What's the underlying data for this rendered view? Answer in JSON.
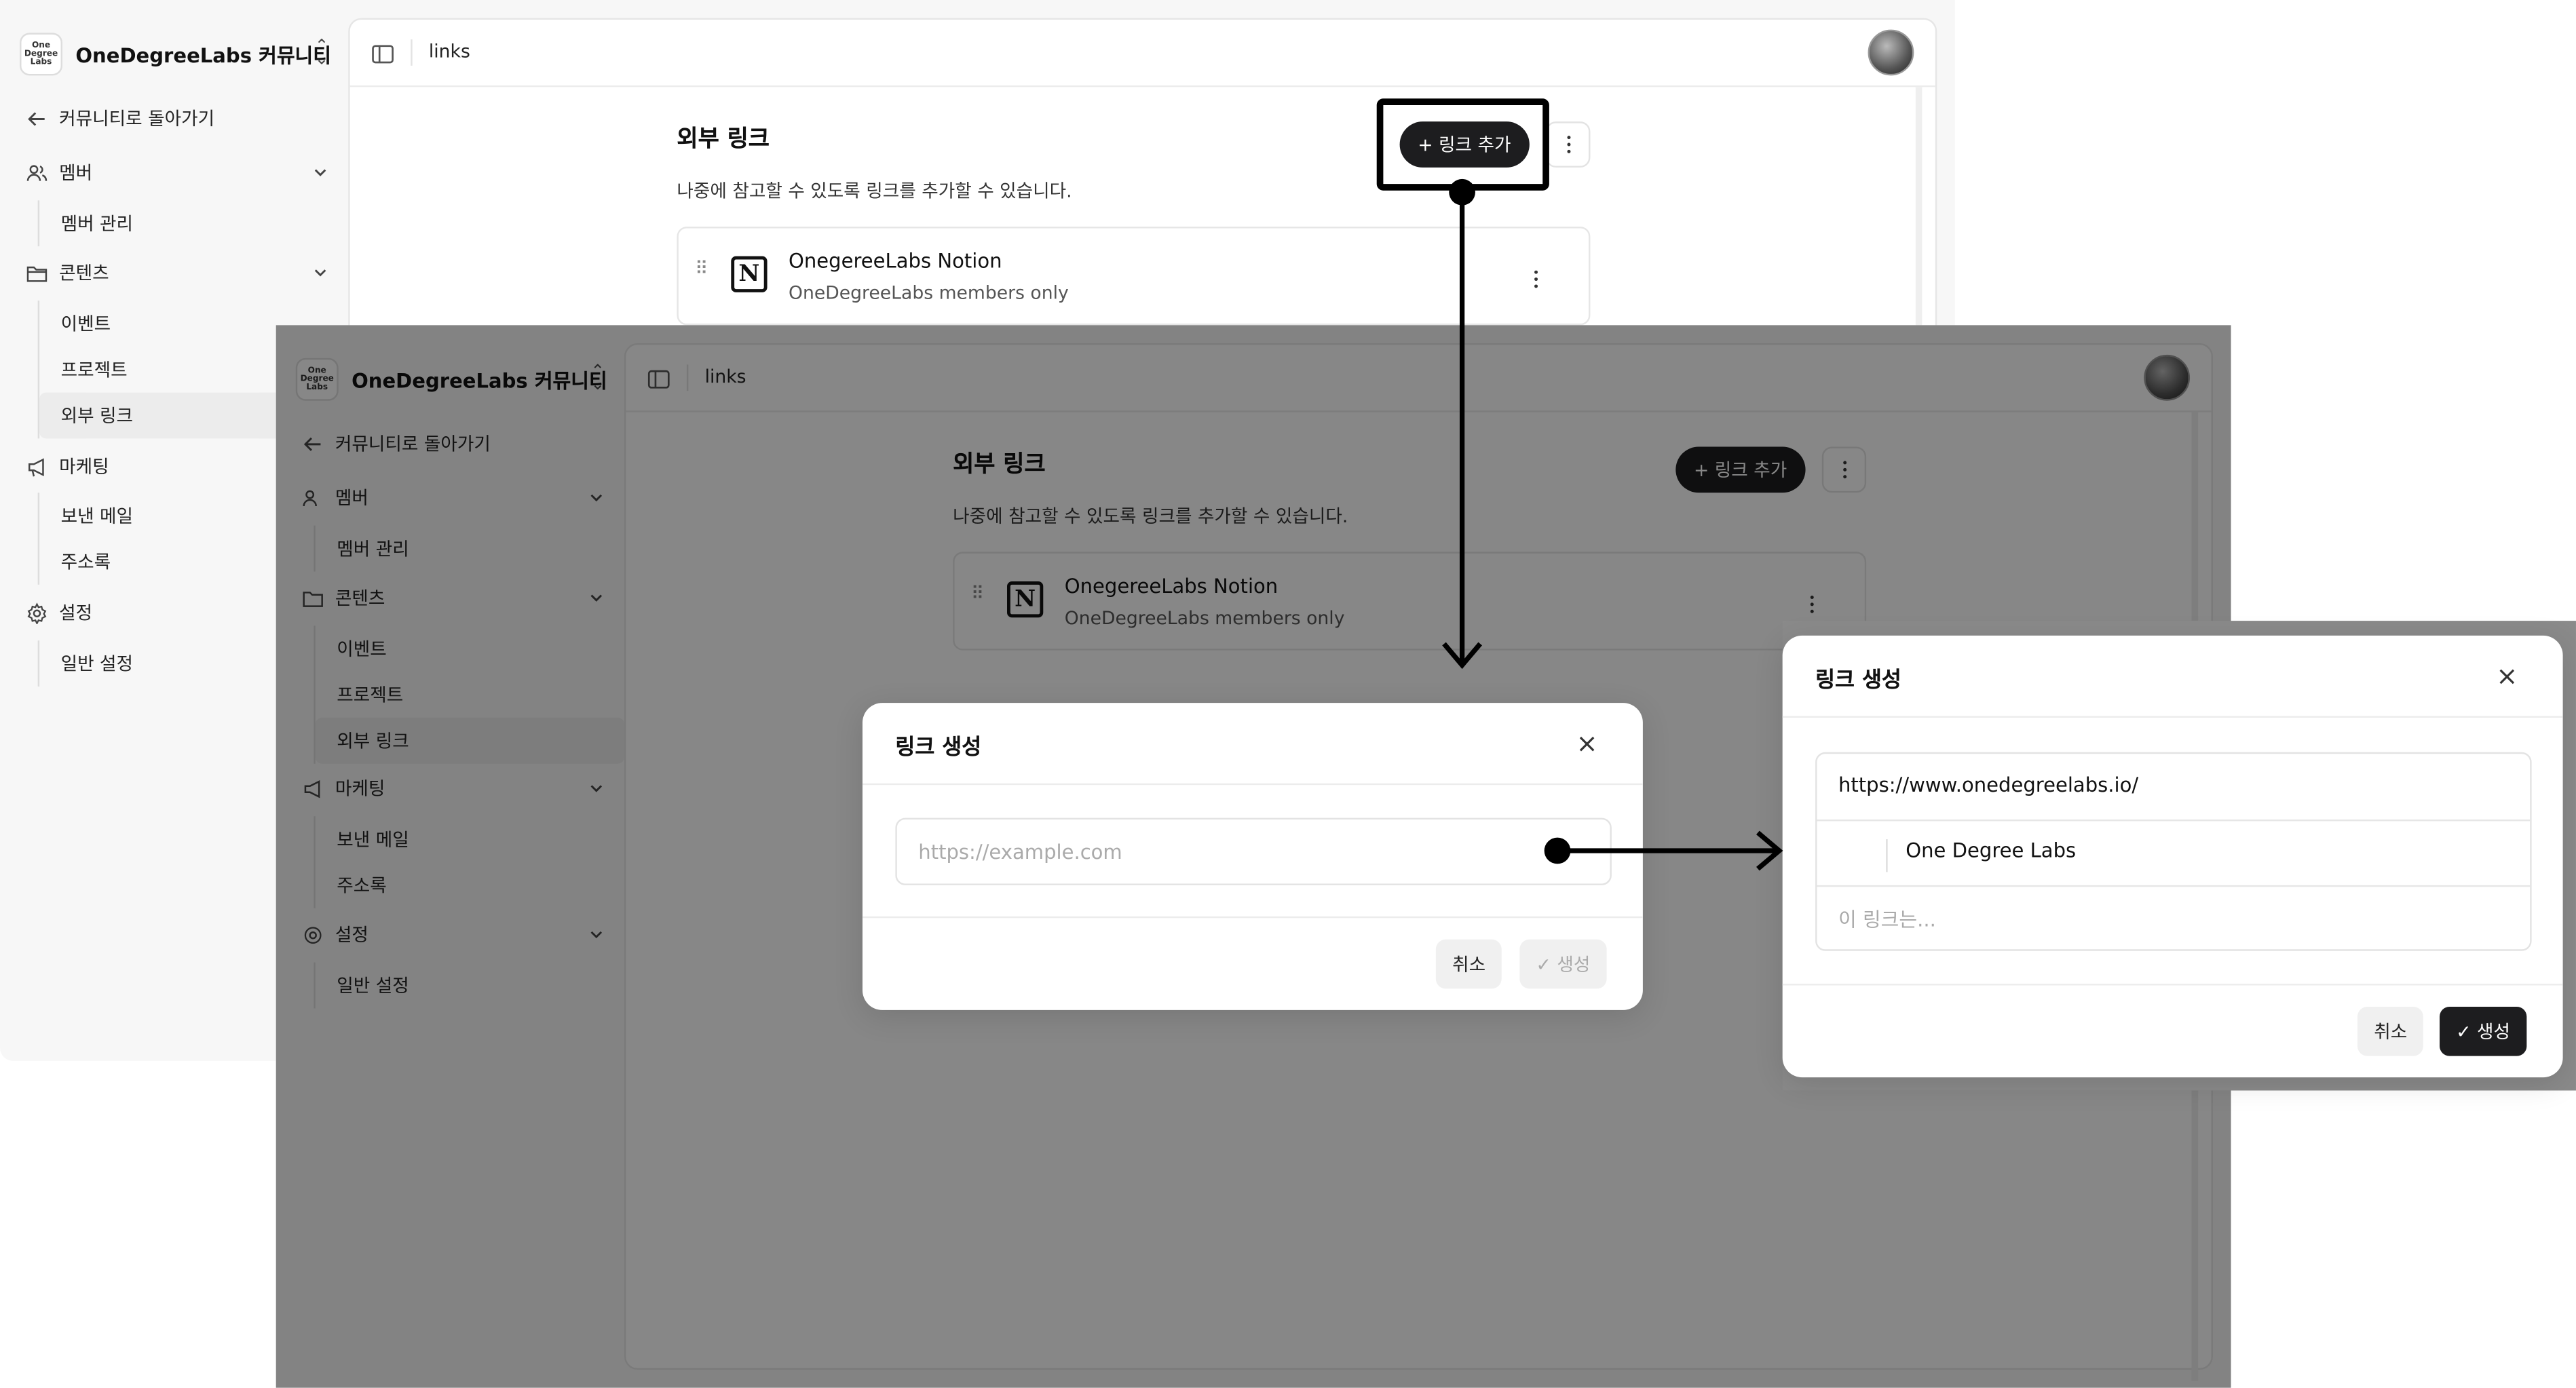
{
  "sidebar": {
    "org_logo": "One Degree Labs",
    "org_name": "OneDegreeLabs 커뮤니티",
    "back_label": "커뮤니티로 돌아가기",
    "groups": [
      {
        "label": "멤버",
        "icon": "users-icon",
        "items": [
          "멤버 관리"
        ]
      },
      {
        "label": "콘텐츠",
        "icon": "folder-icon",
        "items": [
          "이벤트",
          "프로젝트",
          "외부 링크"
        ]
      },
      {
        "label": "마케팅",
        "icon": "megaphone-icon",
        "items": [
          "보낸 메일",
          "주소록"
        ]
      },
      {
        "label": "설정",
        "icon": "gear-icon",
        "items": [
          "일반 설정"
        ]
      }
    ],
    "active_item": "외부 링크"
  },
  "header": {
    "breadcrumb": "links"
  },
  "page": {
    "title": "외부 링크",
    "description": "나중에 참고할 수 있도록 링크를 추가할 수 있습니다.",
    "add_button": "+ 링크 추가",
    "links": [
      {
        "name": "OnegereeLabs Notion",
        "description": "OneDegreeLabs members only",
        "icon": "notion-icon"
      }
    ]
  },
  "dialog_empty": {
    "title": "링크 생성",
    "url_placeholder": "https://example.com",
    "cancel": "취소",
    "create": "✓ 생성"
  },
  "dialog_filled": {
    "title": "링크 생성",
    "url_value": "https://www.onedegreelabs.io/",
    "name_value": "One Degree Labs",
    "desc_placeholder": "이 링크는...",
    "cancel": "취소",
    "create": "✓ 생성"
  },
  "colors": {
    "primary_button": "#1d1d1f",
    "overlay": "rgba(0,0,0,0.47)",
    "sidebar_bg": "#f7f7f7"
  }
}
